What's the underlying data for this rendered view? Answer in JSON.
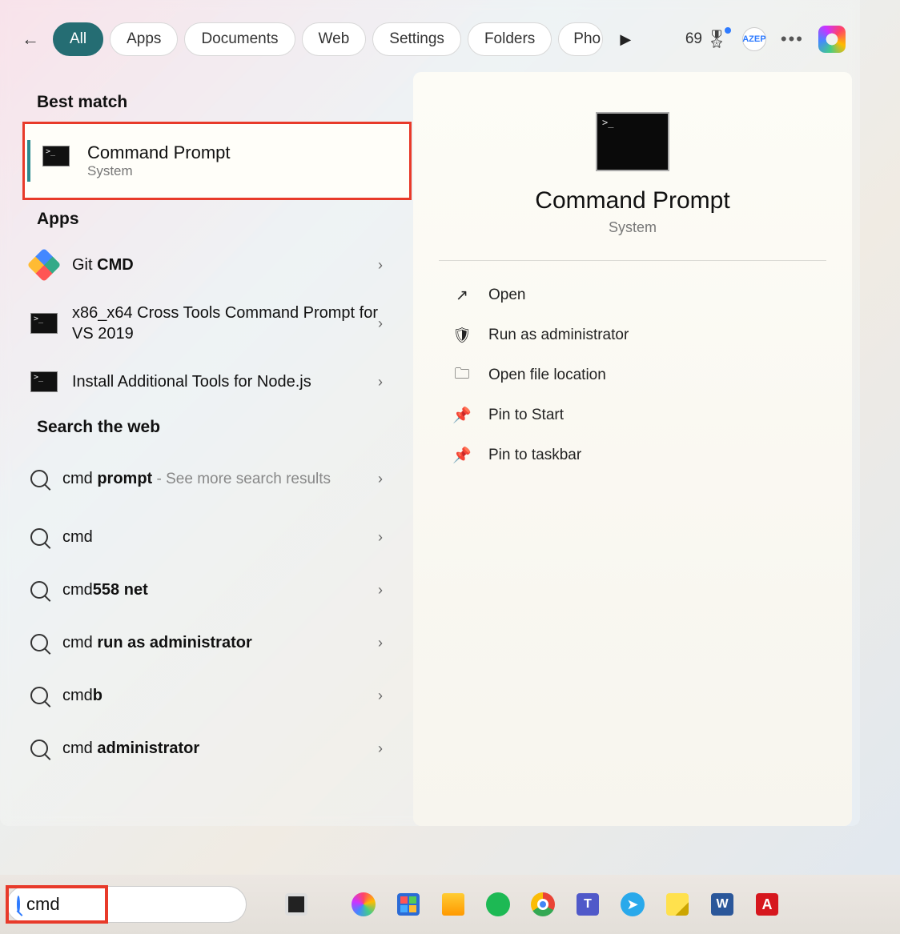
{
  "tabs": [
    "All",
    "Apps",
    "Documents",
    "Web",
    "Settings",
    "Folders",
    "Pho"
  ],
  "score": "69",
  "avatar_text": "AZEP",
  "sections": {
    "best_match": "Best match",
    "apps": "Apps",
    "web": "Search the web"
  },
  "best": {
    "title": "Command Prompt",
    "subtitle": "System"
  },
  "apps": [
    {
      "pre": "Git ",
      "bold": "CMD",
      "post": ""
    },
    {
      "pre": "",
      "bold": "",
      "post": "x86_x64 Cross Tools Command Prompt for VS 2019"
    },
    {
      "pre": "",
      "bold": "",
      "post": "Install Additional Tools for Node.js"
    }
  ],
  "web": [
    {
      "pre": "cmd ",
      "bold": "prompt",
      "suffix": " - See more search results"
    },
    {
      "pre": "cmd",
      "bold": "",
      "suffix": ""
    },
    {
      "pre": "cmd",
      "bold": "558 net",
      "suffix": ""
    },
    {
      "pre": "cmd ",
      "bold": "run as administrator",
      "suffix": ""
    },
    {
      "pre": "cmd",
      "bold": "b",
      "suffix": ""
    },
    {
      "pre": "cmd ",
      "bold": "administrator",
      "suffix": ""
    }
  ],
  "detail": {
    "title": "Command Prompt",
    "subtitle": "System"
  },
  "actions": [
    "Open",
    "Run as administrator",
    "Open file location",
    "Pin to Start",
    "Pin to taskbar"
  ],
  "searchbox": {
    "value": "cmd"
  }
}
